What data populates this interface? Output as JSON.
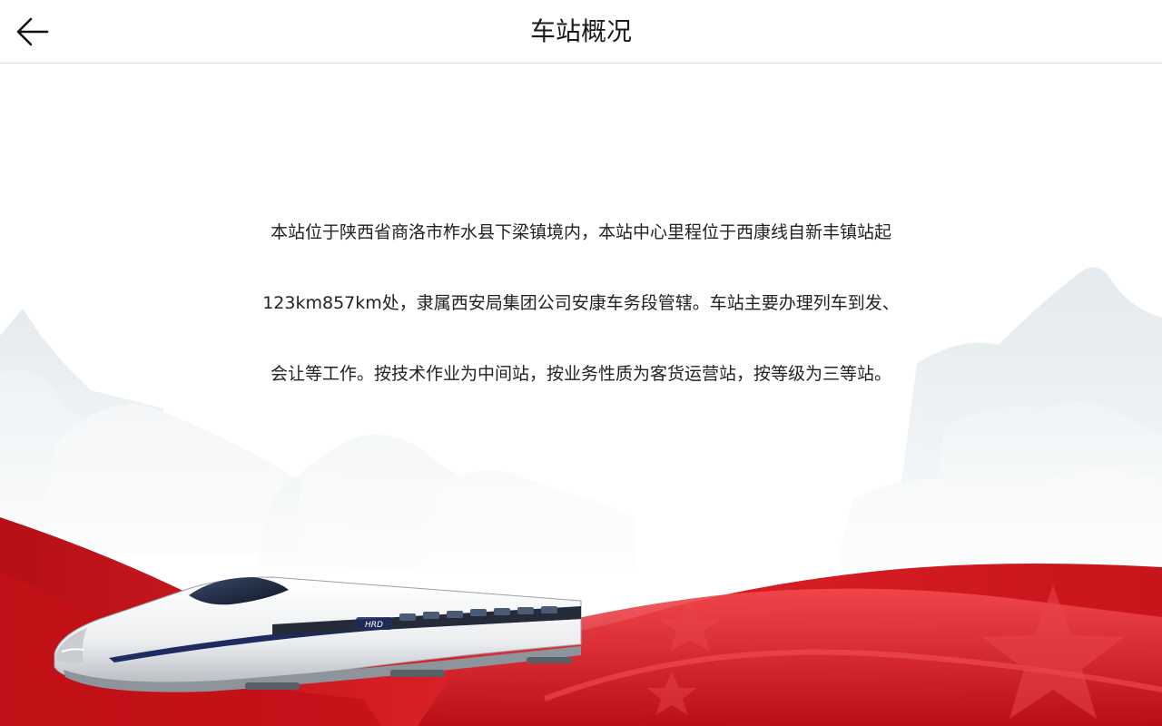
{
  "header": {
    "title": "车站概况",
    "back_icon": "arrow-left-icon"
  },
  "content": {
    "lines": [
      "本站位于陕西省商洛市柞水县下梁镇境内，本站中心里程位于西康线自新丰镇站起",
      "123km857km处，隶属西安局集团公司安康车务段管辖。车站主要办理列车到发、",
      "会让等工作。按技术作业为中间站，按业务性质为客货运营站，按等级为三等站。"
    ]
  },
  "background": {
    "train_livery_text": "HRD",
    "colors": {
      "red": "#d8141c",
      "dark_red": "#a50d12",
      "mist": "#dfe7ec",
      "train_white": "#f2f3f4",
      "stripe": "#1d2b5e"
    }
  }
}
